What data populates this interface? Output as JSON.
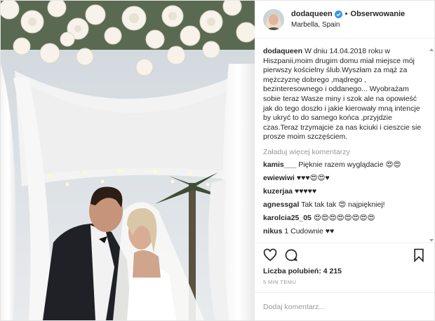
{
  "header": {
    "username": "dodaqueen",
    "verified_icon": "verified-badge-icon",
    "separator": "•",
    "follow_label": "Obserwowanie",
    "location": "Marbella, Spain"
  },
  "caption": {
    "username": "dodaqueen",
    "text": "W dniu 14.04.2018 roku w Hiszpanii,moim drugim domu miał miejsce mój pierwszy kościelny ślub.Wyszłam za mąż za mężczyznę dobrego ,mądrego , bezinteresownego i oddanego... Wyobrażam sobie teraz Wasze miny i szok ale na opowieść jak do tego doszło i jakie kierowały mną intencje by ukryć to do samego końca ,przyjdzie czas.Teraz trzymajcie za nas kciuki i cieszcie sie prosze moim szczęściem."
  },
  "load_more": "Załaduj więcej komentarzy",
  "comments": [
    {
      "user": "kamis___",
      "text": "Pięknie razem wyglądacie 😍😍"
    },
    {
      "user": "ewiewiwi",
      "text": "♥♥♥😍😍♥"
    },
    {
      "user": "kuzerjaa",
      "text": "♥♥♥♥♥"
    },
    {
      "user": "agnessgal",
      "text": "Tak tak tak 😍 najpiękniej!"
    },
    {
      "user": "karolcia25_05",
      "text": "😍😍😍😍😍😍😍😍"
    },
    {
      "user": "nikus",
      "text": "1 Cudownie ♥♥"
    }
  ],
  "actions": {
    "like_icon": "heart-icon",
    "comment_icon": "comment-icon",
    "save_icon": "bookmark-icon"
  },
  "likes": "Liczba polubień: 4 215",
  "time_ago": "5 MIN TEMU",
  "add_comment_placeholder": "Dodaj komentarz...",
  "colors": {
    "text": "#262626",
    "muted": "#999999",
    "verified": "#3897f0",
    "border": "#efefef"
  }
}
